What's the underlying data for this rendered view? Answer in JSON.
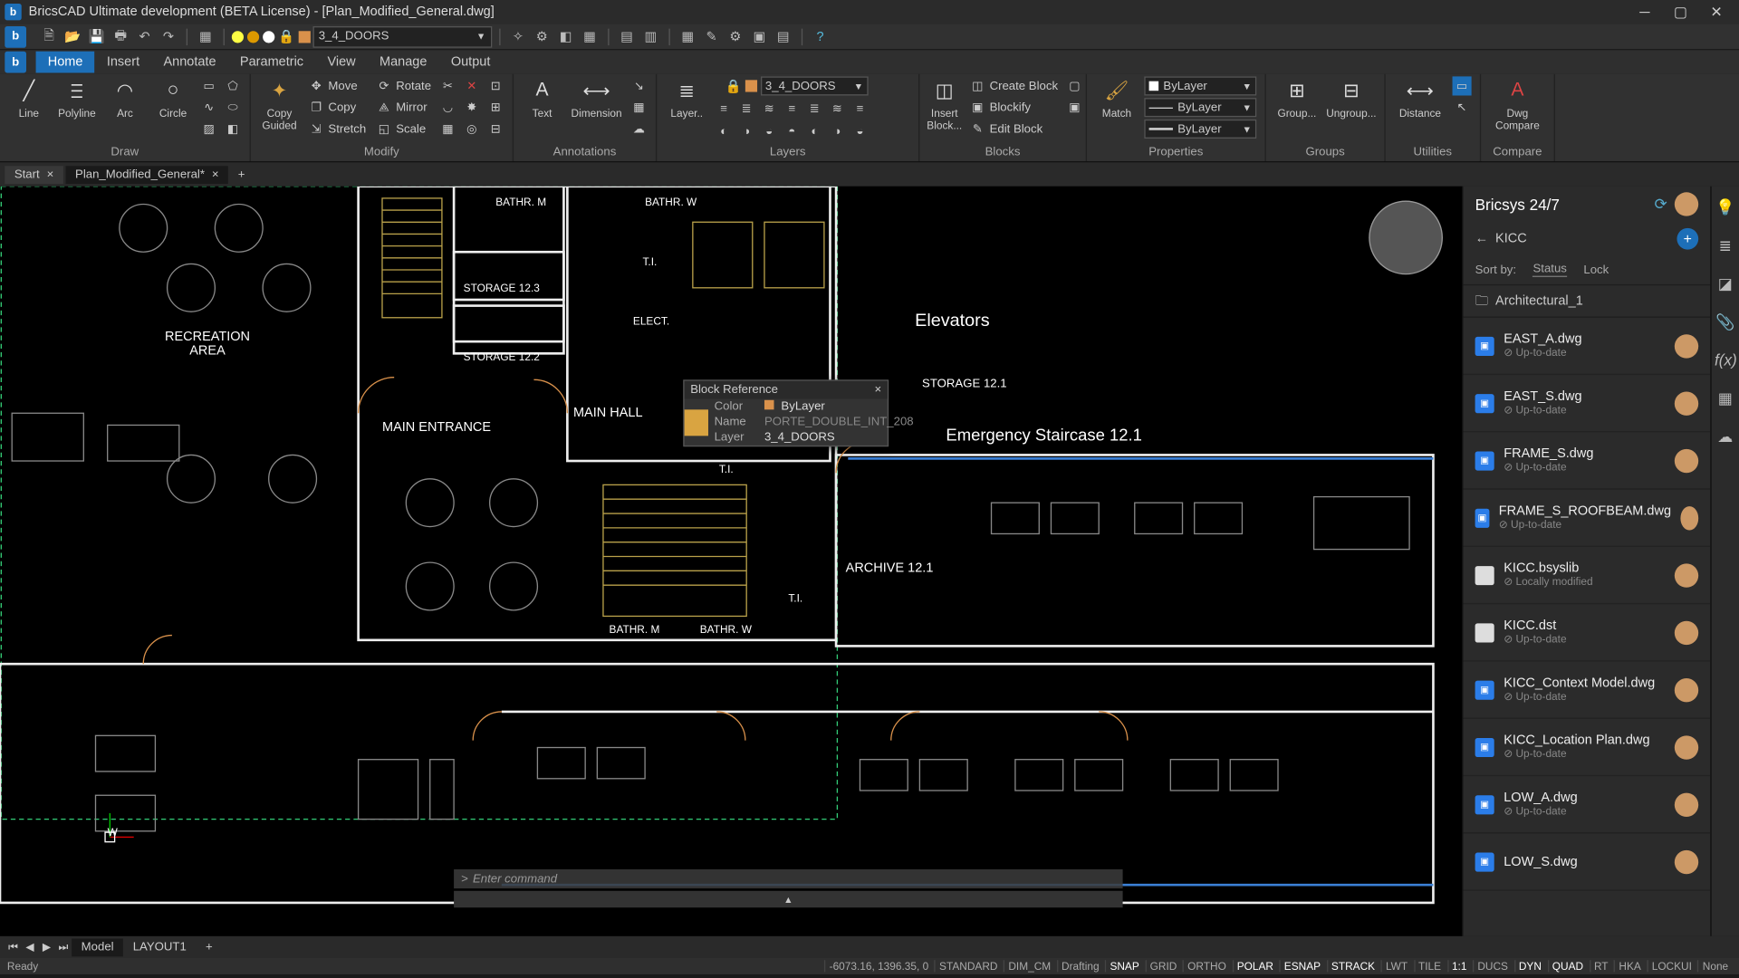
{
  "titlebar": {
    "title": "BricsCAD Ultimate development (BETA License) - [Plan_Modified_General.dwg]"
  },
  "menus": [
    "Home",
    "Insert",
    "Annotate",
    "Parametric",
    "View",
    "Manage",
    "Output"
  ],
  "qat": {
    "layer": "3_4_DOORS"
  },
  "ribbon": {
    "draw": {
      "name": "Draw",
      "line": "Line",
      "polyline": "Polyline",
      "arc": "Arc",
      "circle": "Circle"
    },
    "modify": {
      "name": "Modify",
      "copyguided": "Copy\nGuided",
      "move": "Move",
      "copy": "Copy",
      "stretch": "Stretch",
      "rotate": "Rotate",
      "mirror": "Mirror",
      "scale": "Scale"
    },
    "annotations": {
      "name": "Annotations",
      "text": "Text",
      "dimension": "Dimension"
    },
    "layers": {
      "name": "Layers",
      "big": "Layer..",
      "layer": "3_4_DOORS"
    },
    "blocks": {
      "name": "Blocks",
      "insert": "Insert\nBlock...",
      "create": "Create Block",
      "blockify": "Blockify",
      "edit": "Edit Block"
    },
    "properties": {
      "name": "Properties",
      "match": "Match",
      "bylayer": "ByLayer"
    },
    "groups": {
      "name": "Groups",
      "group": "Group...",
      "ungroup": "Ungroup..."
    },
    "utilities": {
      "name": "Utilities",
      "distance": "Distance"
    },
    "compare": {
      "name": "Compare",
      "dwg": "Dwg\nCompare"
    }
  },
  "doctabs": {
    "start": "Start",
    "file": "Plan_Modified_General*"
  },
  "plan": {
    "recreation_area": "RECREATION\nAREA",
    "bathr_m": "BATHR. M",
    "bathr_w": "BATHR. W",
    "storage123": "STORAGE 12.3",
    "storage122": "STORAGE 12.2",
    "storage121": "STORAGE 12.1",
    "main_entrance": "MAIN ENTRANCE",
    "main_hall": "MAIN HALL",
    "elect": "ELECT.",
    "ti": "T.I.",
    "elevators": "Elevators",
    "emergency": "Emergency Staircase 12.1",
    "archive": "ARCHIVE 12.1"
  },
  "tooltip": {
    "title": "Block Reference",
    "color_k": "Color",
    "color_v": "ByLayer",
    "name_k": "Name",
    "name_v": "PORTE_DOUBLE_INT_208",
    "layer_k": "Layer",
    "layer_v": "3_4_DOORS"
  },
  "cmdline": "Enter command",
  "panel": {
    "title": "Bricsys 24/7",
    "project": "KICC",
    "sortby": "Sort by:",
    "status_h": "Status",
    "lock_h": "Lock",
    "folder": "Architectural_1",
    "files": [
      {
        "name": "EAST_A.dwg",
        "status": "Up-to-date",
        "kind": "dwg"
      },
      {
        "name": "EAST_S.dwg",
        "status": "Up-to-date",
        "kind": "dwg"
      },
      {
        "name": "FRAME_S.dwg",
        "status": "Up-to-date",
        "kind": "dwg"
      },
      {
        "name": "FRAME_S_ROOFBEAM.dwg",
        "status": "Up-to-date",
        "kind": "dwg"
      },
      {
        "name": "KICC.bsyslib",
        "status": "Locally modified",
        "kind": "doc"
      },
      {
        "name": "KICC.dst",
        "status": "Up-to-date",
        "kind": "doc"
      },
      {
        "name": "KICC_Context Model.dwg",
        "status": "Up-to-date",
        "kind": "dwg"
      },
      {
        "name": "KICC_Location Plan.dwg",
        "status": "Up-to-date",
        "kind": "dwg"
      },
      {
        "name": "LOW_A.dwg",
        "status": "Up-to-date",
        "kind": "dwg"
      },
      {
        "name": "LOW_S.dwg",
        "status": "",
        "kind": "dwg"
      }
    ]
  },
  "btabs": {
    "model": "Model",
    "layout": "LAYOUT1"
  },
  "status": {
    "ready": "Ready",
    "coords": "-6073.16, 1396.35, 0",
    "items": [
      "STANDARD",
      "DIM_CM",
      "Drafting",
      "SNAP",
      "GRID",
      "ORTHO",
      "POLAR",
      "ESNAP",
      "STRACK",
      "LWT",
      "TILE",
      "1:1",
      "DUCS",
      "DYN",
      "QUAD",
      "RT",
      "HKA",
      "LOCKUI",
      "None"
    ]
  }
}
